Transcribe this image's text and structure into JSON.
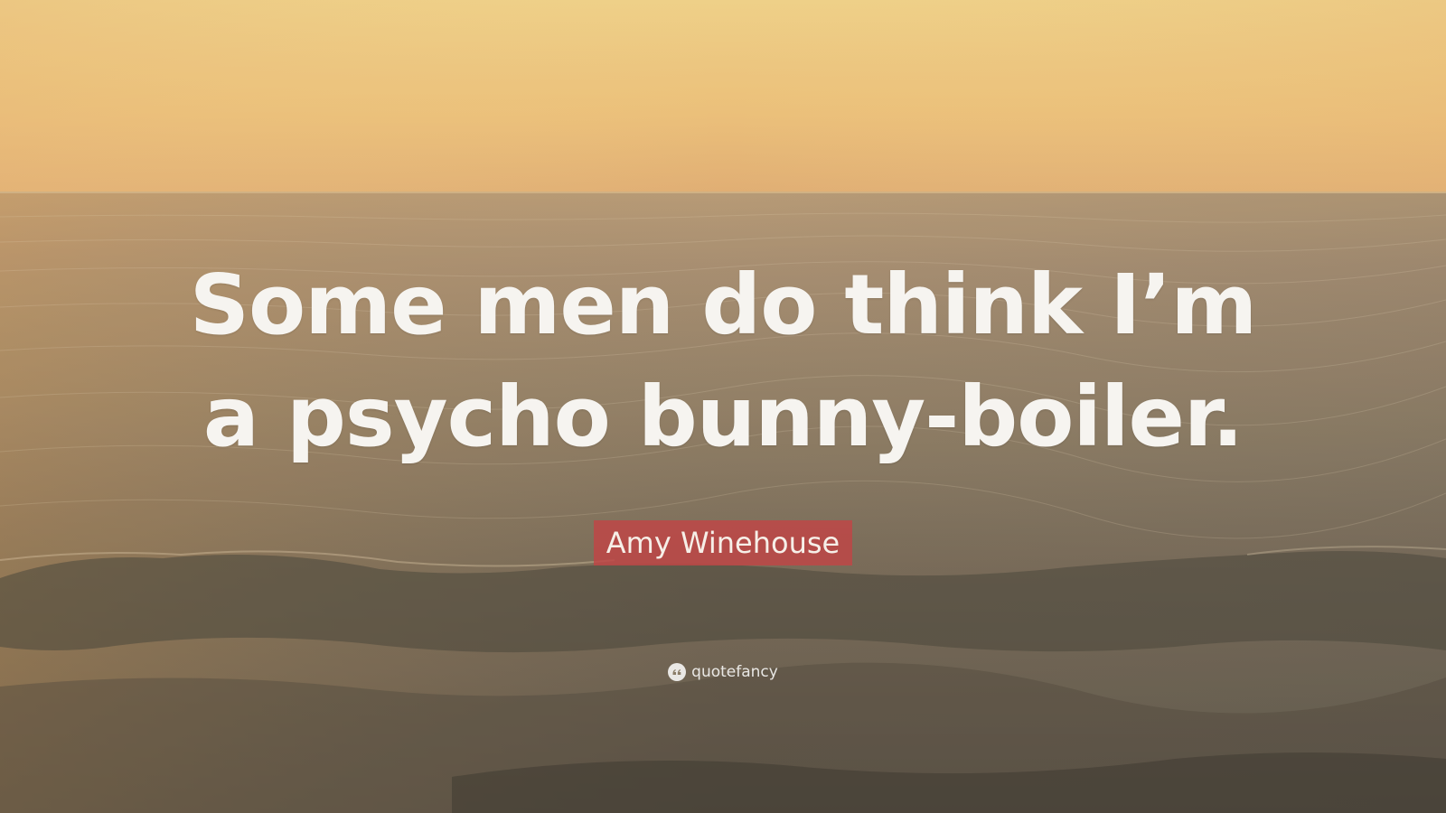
{
  "quote": {
    "lines": [
      "Some men do think I’m",
      "a psycho bunny-boiler."
    ]
  },
  "author": {
    "name": "Amy Winehouse",
    "badge_color": "#be4646"
  },
  "brand": {
    "name": "quotefancy",
    "icon": "quote-mark-icon"
  },
  "background": {
    "description_icon": "sea-sunset-image",
    "sky_color": "#f6c67a",
    "sea_color": "#6b6455"
  }
}
